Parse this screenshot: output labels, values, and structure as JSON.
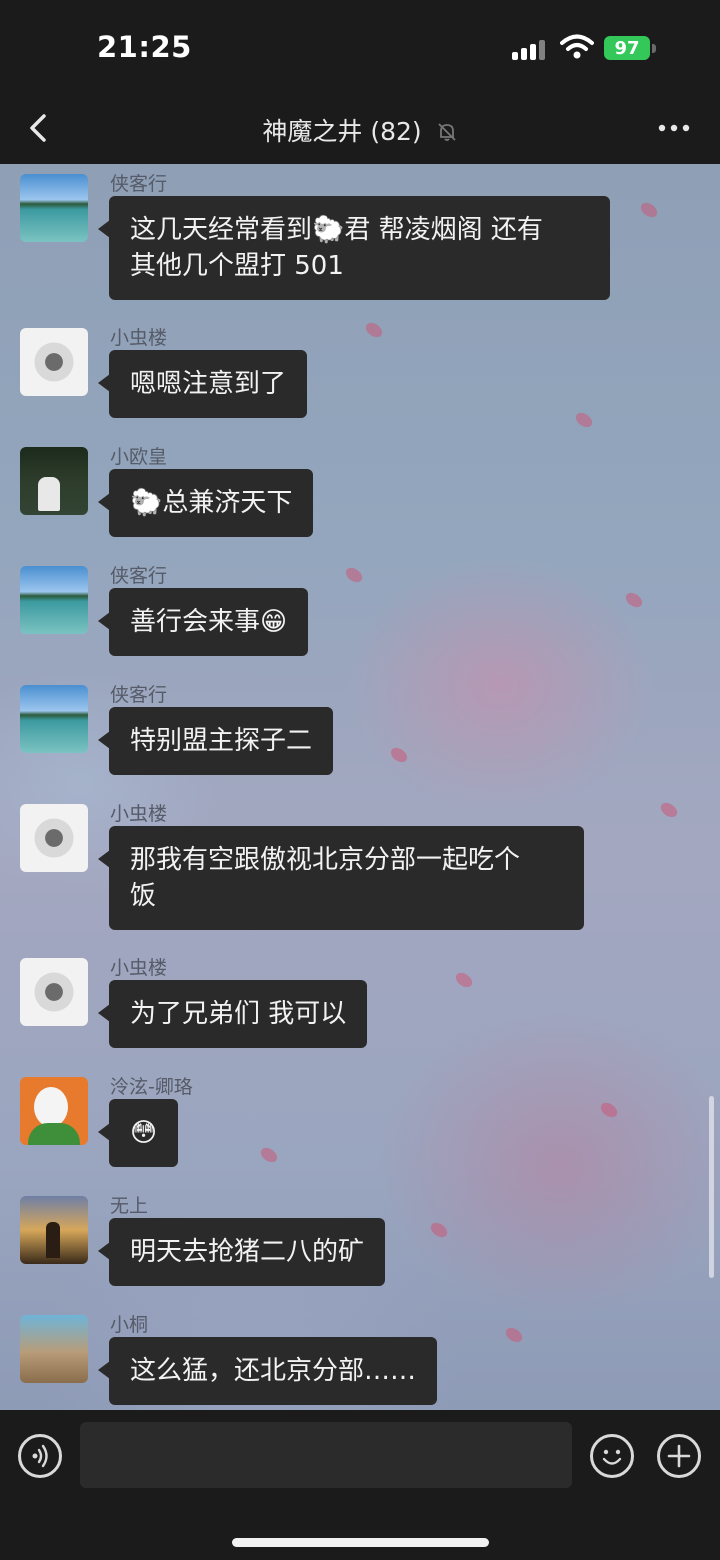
{
  "status_bar": {
    "time": "21:25",
    "battery": "97"
  },
  "nav": {
    "title": "神魔之井 (82)",
    "back_icon": "chevron-left-icon",
    "mute_icon": "bell-slash-icon",
    "more_icon": "ellipsis-icon"
  },
  "messages": [
    {
      "sender": "侠客行",
      "avatar": "beach",
      "text": "这几天经常看到🐑君 帮凌烟阁 还有\n其他几个盟打 501"
    },
    {
      "sender": "小虫楼",
      "avatar": "kitten",
      "text": "嗯嗯注意到了"
    },
    {
      "sender": "小欧皇",
      "avatar": "forest",
      "text": "🐑总兼济天下"
    },
    {
      "sender": "侠客行",
      "avatar": "beach",
      "text": "善行会来事😁"
    },
    {
      "sender": "侠客行",
      "avatar": "beach",
      "text": "特别盟主探子二"
    },
    {
      "sender": "小虫楼",
      "avatar": "kitten",
      "text": "那我有空跟傲视北京分部一起吃个\n饭"
    },
    {
      "sender": "小虫楼",
      "avatar": "kitten",
      "text": "为了兄弟们 我可以"
    },
    {
      "sender": "泠泫-卿珞",
      "avatar": "duck",
      "text": "😳"
    },
    {
      "sender": "无上",
      "avatar": "sunrise",
      "text": "明天去抢猪二八的矿"
    },
    {
      "sender": "小桐",
      "avatar": "cat",
      "text": "这么猛，还北京分部……"
    }
  ],
  "input_bar": {
    "voice_icon": "voice-icon",
    "emoji_icon": "smile-icon",
    "plus_icon": "plus-icon",
    "value": ""
  }
}
